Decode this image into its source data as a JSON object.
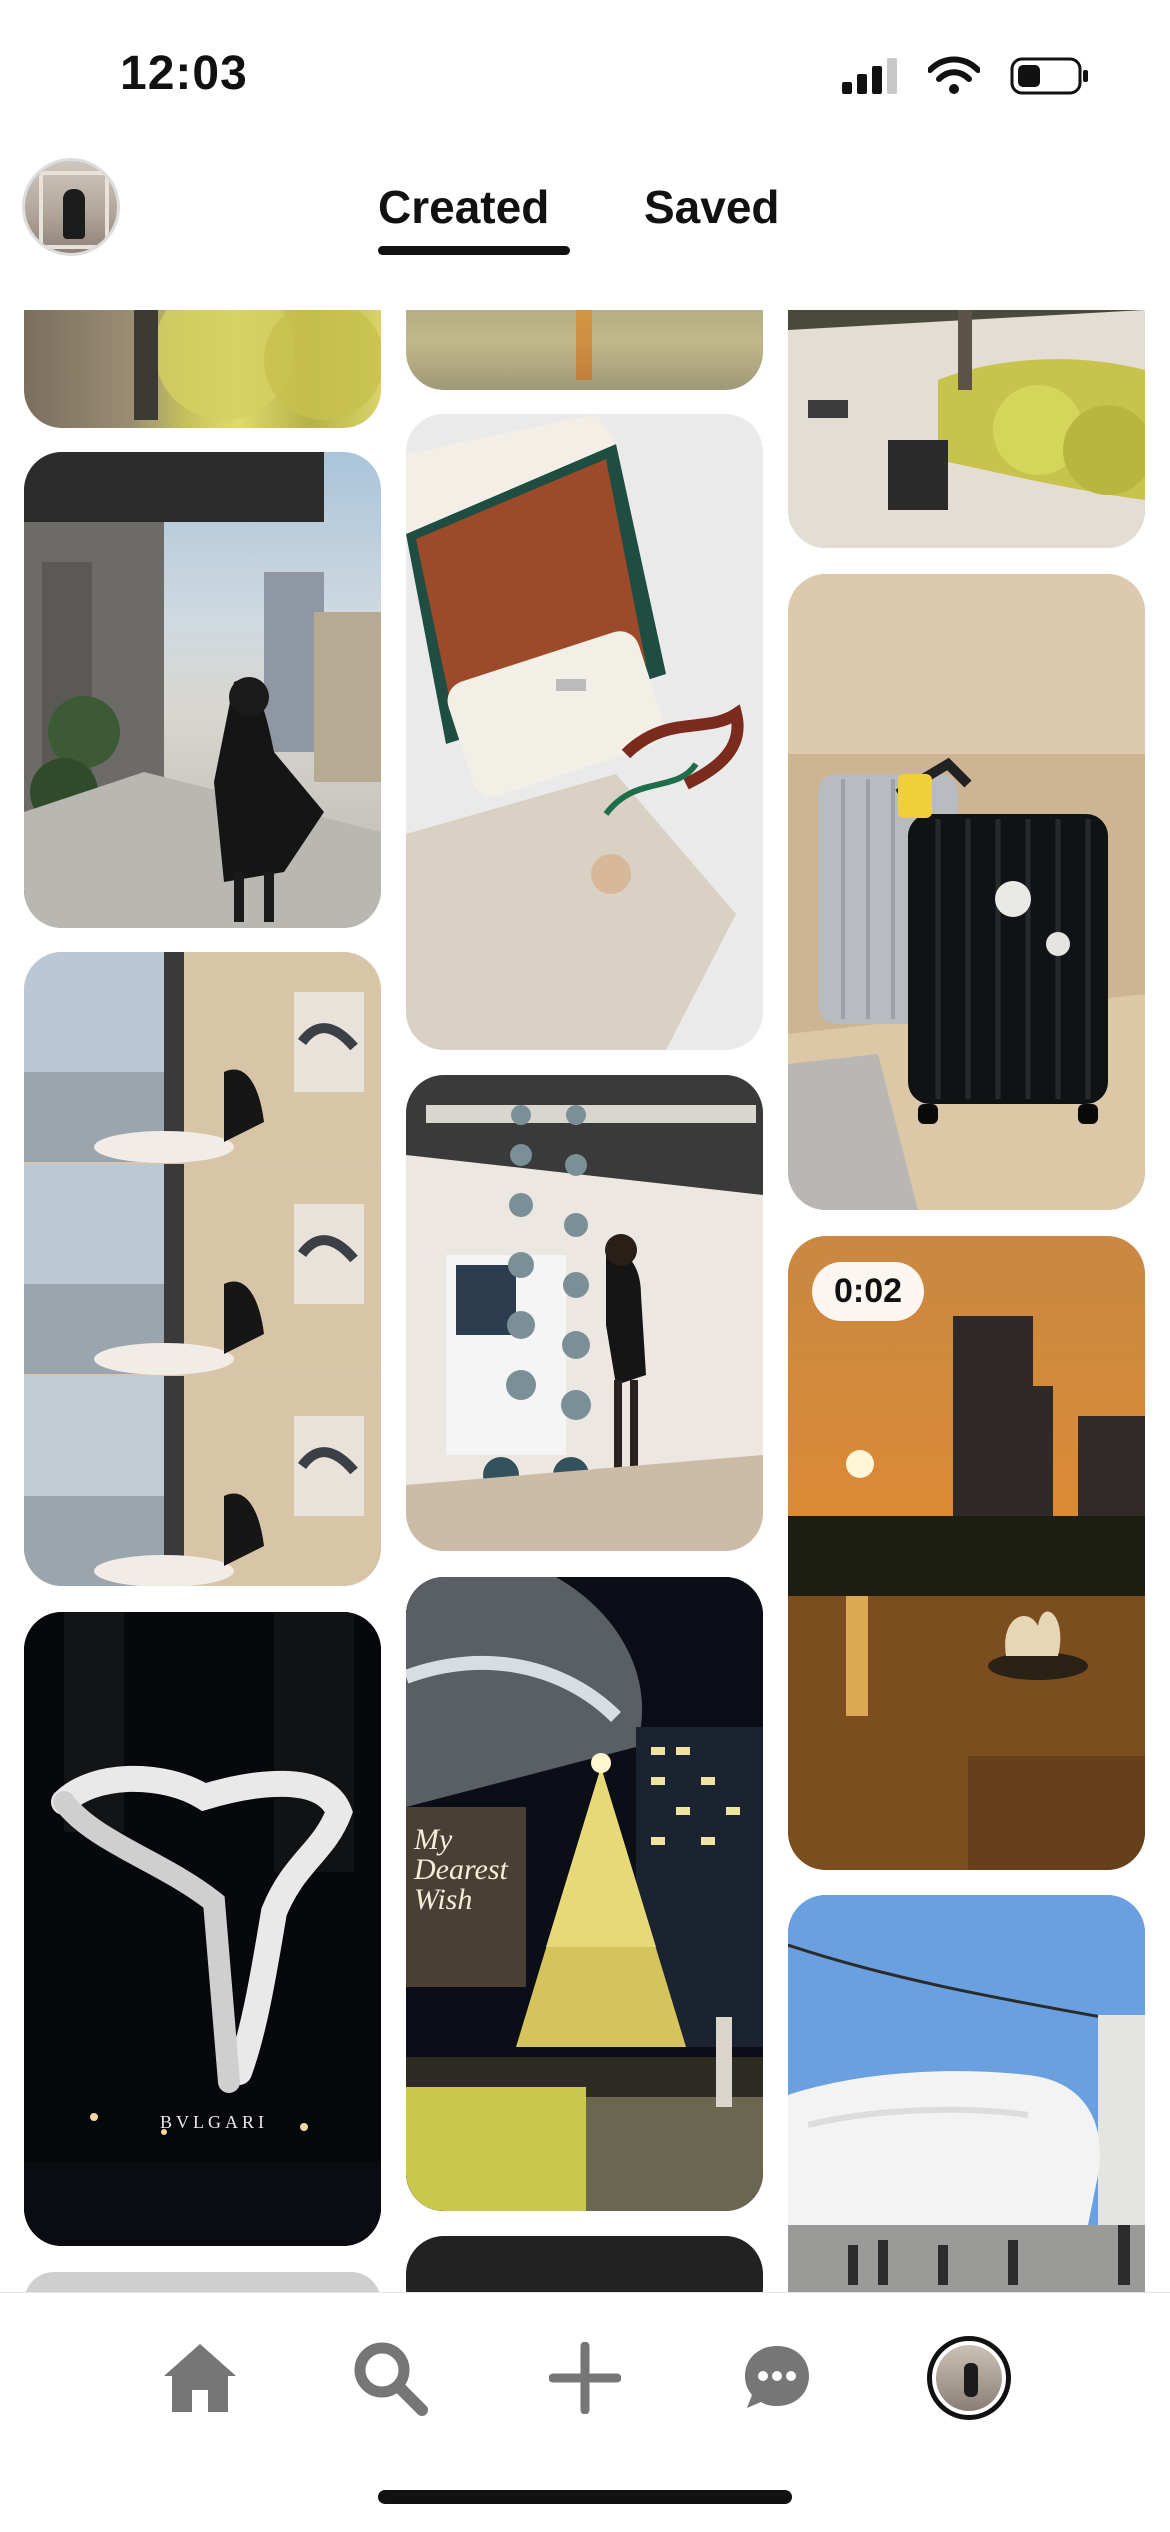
{
  "status_bar": {
    "time": "12:03",
    "icons": [
      "cellular-signal-icon",
      "wifi-icon",
      "battery-icon"
    ]
  },
  "header": {
    "avatar": "profile-avatar",
    "tabs": [
      {
        "label": "Created",
        "active": true
      },
      {
        "label": "Saved",
        "active": false
      }
    ]
  },
  "pins": [
    {
      "id": "pin-christmas-shrubs-top",
      "kind": "photo"
    },
    {
      "id": "pin-sunset-water-top",
      "kind": "photo"
    },
    {
      "id": "pin-lit-planter-walkway",
      "kind": "photo"
    },
    {
      "id": "pin-street-woman-twirl",
      "kind": "photo"
    },
    {
      "id": "pin-loro-piana-bag",
      "kind": "photo"
    },
    {
      "id": "pin-rimowa-suitcases",
      "kind": "photo"
    },
    {
      "id": "pin-cafe-window-triptych",
      "kind": "photo"
    },
    {
      "id": "pin-bead-sculpture-gallery",
      "kind": "photo"
    },
    {
      "id": "pin-sunset-lake-video",
      "kind": "video",
      "duration": "0:02"
    },
    {
      "id": "pin-bvlgari-serpenti-night",
      "kind": "photo",
      "sign": "BVLGARI"
    },
    {
      "id": "pin-my-dearest-wish-tree",
      "kind": "photo",
      "sign": "My Dearest Wish"
    },
    {
      "id": "pin-white-sculpture-street",
      "kind": "photo"
    }
  ],
  "bottom_nav": {
    "items": [
      "home-icon",
      "search-icon",
      "create-plus-icon",
      "messages-icon",
      "profile-avatar"
    ]
  },
  "colors": {
    "text": "#111111",
    "nav_icon": "#767676",
    "background": "#ffffff"
  }
}
